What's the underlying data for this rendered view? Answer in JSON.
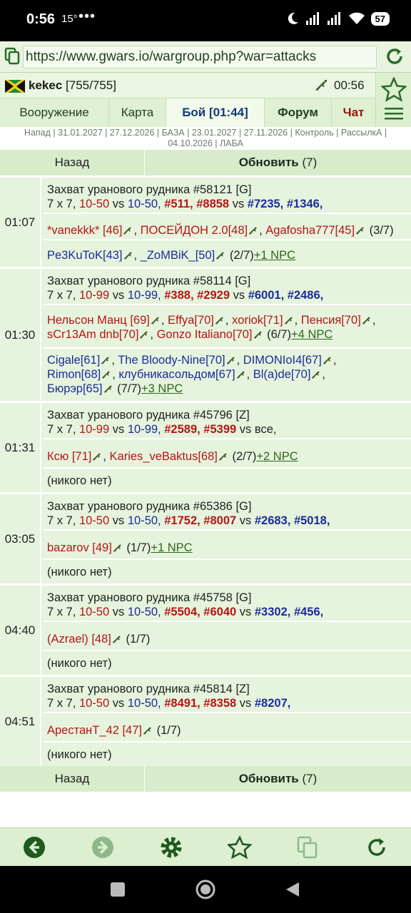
{
  "status": {
    "time": "0:56",
    "temp": "15°",
    "dots": "•••",
    "battery": "57"
  },
  "url": "https://www.gwars.io/wargroup.php?war=attacks",
  "user": {
    "name": "kekec",
    "hp": "[755/755]",
    "clock": "00:56"
  },
  "tabs": [
    {
      "label": "Вооружение"
    },
    {
      "label": "Карта"
    },
    {
      "label": "Бой [01:44]"
    },
    {
      "label": "Форум"
    },
    {
      "label": "Чат"
    }
  ],
  "breadcrumbs": "Напад | 31.01.2027 | 27.12.2026 | БАЗА | 23.01.2027 | 27.11.2026 | Контроль | РассылкА | 04.10.2026 | ЛАБА",
  "nav": {
    "back": "Назад",
    "refresh": "Обновить",
    "refresh_count": "(7)"
  },
  "battles": [
    {
      "time": "01:07",
      "title": "Захват уранового рудника #58121 [G]",
      "size": "7 x 7,",
      "lvl_red": "10-50",
      "vs": "vs",
      "lvl_blue": "10-50,",
      "red_ids": [
        "#511,",
        "#8858"
      ],
      "blue_ids": [
        "#7235,",
        "#1346,"
      ],
      "red_players": [
        "*vanekkk* [46]",
        "ПОСЕЙДОН 2.0[48]",
        "Agafosha777[45]"
      ],
      "red_count": "(3/7)",
      "blue_players": [
        "Pe3KuToK[43]",
        "_ZoMBiK_[50]"
      ],
      "blue_count": "(2/7)",
      "blue_npc": "+1 NPC"
    },
    {
      "time": "01:30",
      "title": "Захват уранового рудника #58114 [G]",
      "size": "7 x 7,",
      "lvl_red": "10-99",
      "vs": "vs",
      "lvl_blue": "10-99,",
      "red_ids": [
        "#388,",
        "#2929"
      ],
      "blue_ids": [
        "#6001,",
        "#2486,"
      ],
      "red_players": [
        "Нельсон Манц [69]",
        "Effya[70]",
        "xoriok[71]",
        "Пенсия[70]",
        "sCr13Am dnb[70]",
        "Gonzo Italiano[70]"
      ],
      "red_count": "(6/7)",
      "red_npc": "+4 NPC",
      "blue_players": [
        "Cigale[61]",
        "The Bloody-Nine[70]",
        "DIMONIoI4[67]",
        "Rimon[68]",
        "клубникасольдом[67]",
        "Bl(a)de[70]",
        "Бюрэр[65]"
      ],
      "blue_count": "(7/7)",
      "blue_npc": "+3 NPC"
    },
    {
      "time": "01:31",
      "title": "Захват уранового рудника #45796 [Z]",
      "size": "7 x 7,",
      "lvl_red": "10-99",
      "vs": "vs",
      "lvl_blue": "10-99,",
      "red_ids": [
        "#2589,",
        "#5399"
      ],
      "vs_all": "vs все,",
      "red_players": [
        "Ксю [71]",
        "Karies_veBaktus[68]"
      ],
      "red_count": "(2/7)",
      "red_npc": "+2 NPC",
      "nobody": "(никого нет)"
    },
    {
      "time": "03:05",
      "title": "Захват уранового рудника #65386 [G]",
      "size": "7 x 7,",
      "lvl_red": "10-50",
      "vs": "vs",
      "lvl_blue": "10-50,",
      "red_ids": [
        "#1752,",
        "#8007"
      ],
      "blue_ids": [
        "#2683,",
        "#5018,"
      ],
      "red_players": [
        "bazarov [49]"
      ],
      "red_count": "(1/7)",
      "red_npc": "+1 NPC",
      "nobody": "(никого нет)"
    },
    {
      "time": "04:40",
      "title": "Захват уранового рудника #45758 [G]",
      "size": "7 x 7,",
      "lvl_red": "10-50",
      "vs": "vs",
      "lvl_blue": "10-50,",
      "red_ids": [
        "#5504,",
        "#6040"
      ],
      "blue_ids": [
        "#3302,",
        "#456,"
      ],
      "red_players": [
        "(Azrael) [48]"
      ],
      "red_count": "(1/7)",
      "nobody": "(никого нет)"
    },
    {
      "time": "04:51",
      "title": "Захват уранового рудника #45814 [Z]",
      "size": "7 x 7,",
      "lvl_red": "10-50",
      "vs": "vs",
      "lvl_blue": "10-50,",
      "red_ids": [
        "#8491,",
        "#8358"
      ],
      "blue_ids": [
        "#8207,"
      ],
      "red_players": [
        "АрестанТ_42 [47]"
      ],
      "red_count": "(1/7)",
      "nobody": "(никого нет)"
    }
  ],
  "colors": {
    "red": "#b51616",
    "blue": "#1a2c9c",
    "accent": "#2b6a1a",
    "panel": "#e6f3dd"
  },
  "icons": [
    "tabs-icon",
    "reload-icon",
    "flag-icon",
    "gun-icon",
    "star-icon",
    "menu-icon",
    "back-icon",
    "forward-icon",
    "settings-icon"
  ]
}
